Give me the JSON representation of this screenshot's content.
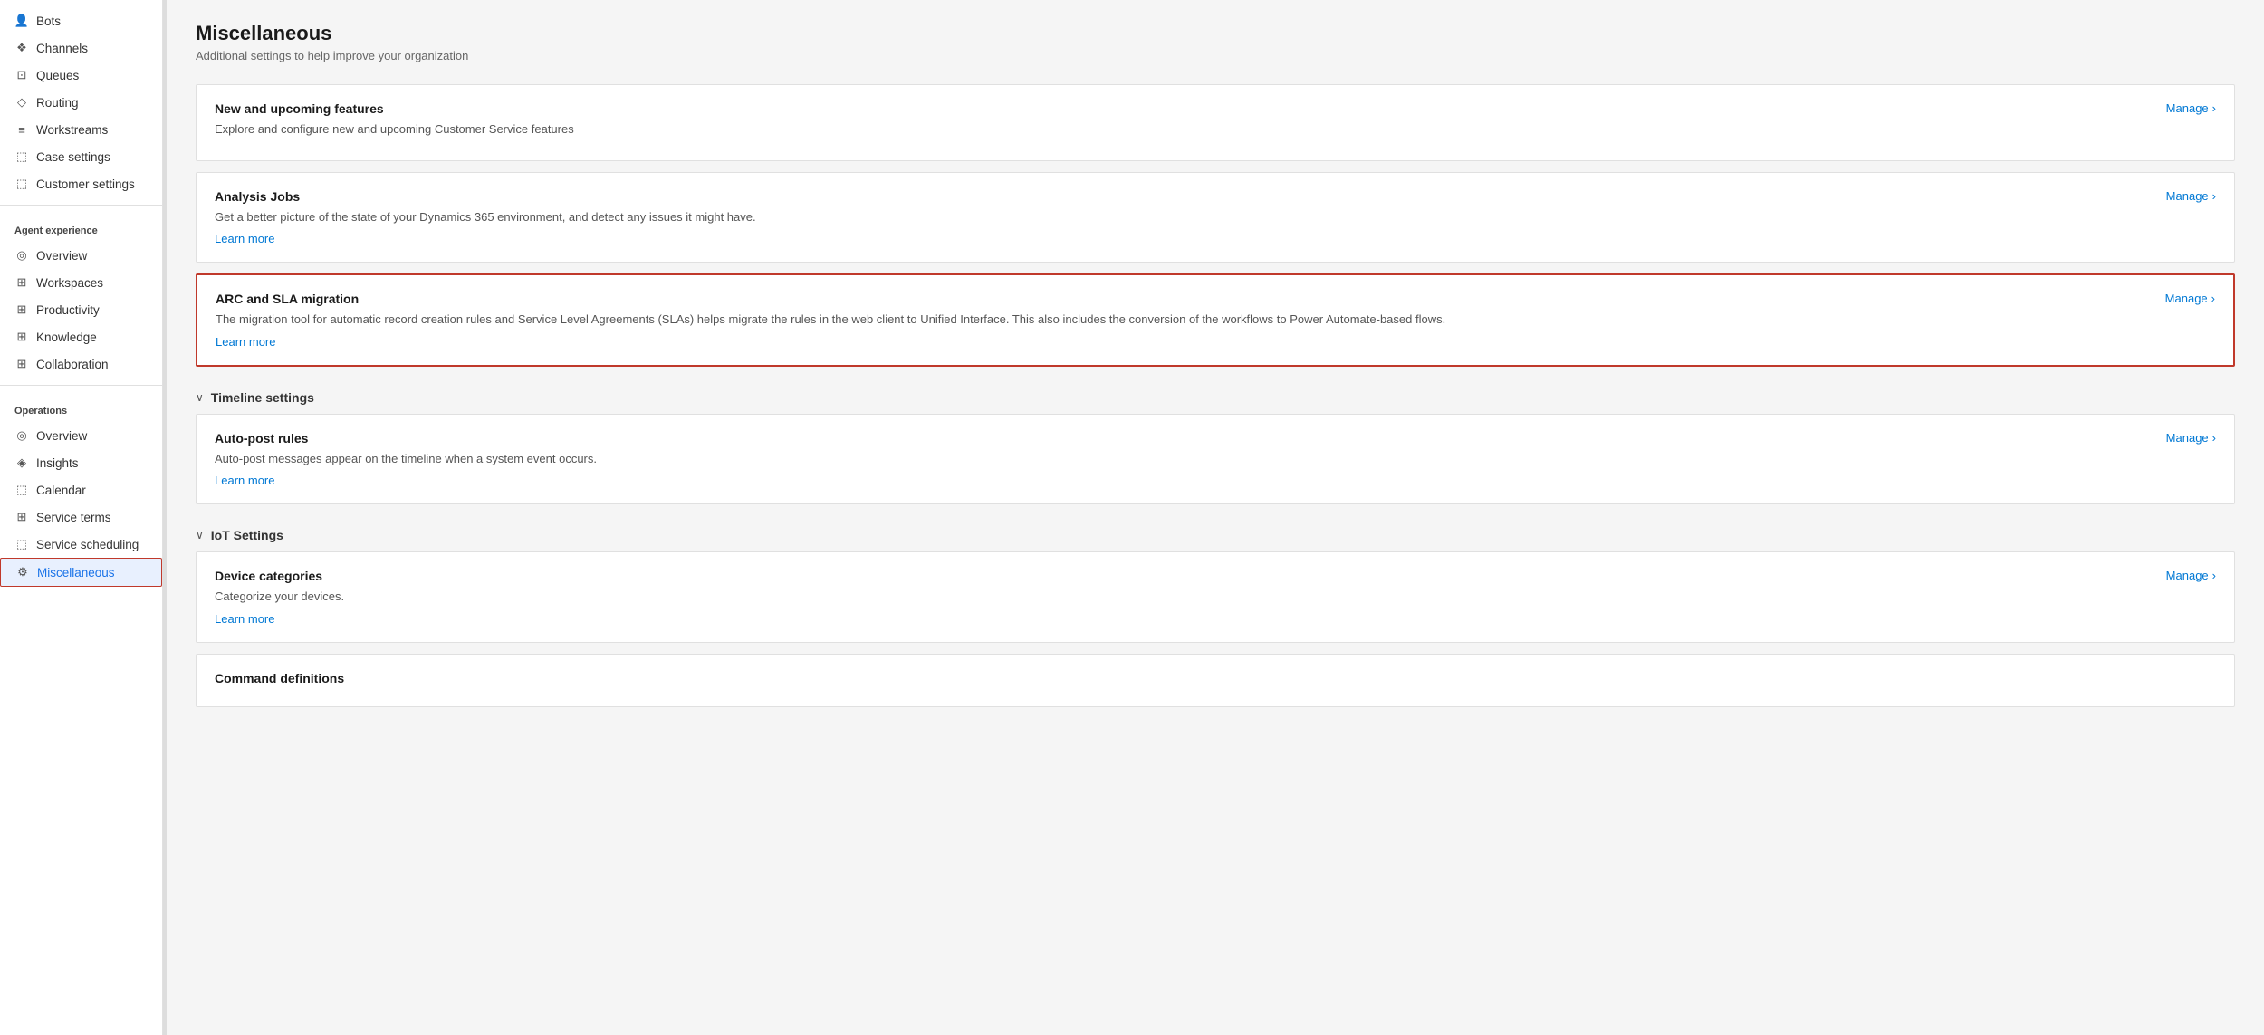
{
  "sidebar": {
    "sections": [
      {
        "items": [
          {
            "label": "Bots",
            "icon": "👤",
            "active": false
          },
          {
            "label": "Channels",
            "icon": "◈",
            "active": false
          },
          {
            "label": "Queues",
            "icon": "⊞",
            "active": false
          },
          {
            "label": "Routing",
            "icon": "◇",
            "active": false
          },
          {
            "label": "Workstreams",
            "icon": "≡",
            "active": false
          },
          {
            "label": "Case settings",
            "icon": "⬚",
            "active": false
          },
          {
            "label": "Customer settings",
            "icon": "⬚",
            "active": false
          }
        ]
      },
      {
        "header": "Agent experience",
        "items": [
          {
            "label": "Overview",
            "icon": "◎",
            "active": false
          },
          {
            "label": "Workspaces",
            "icon": "⊞",
            "active": false
          },
          {
            "label": "Productivity",
            "icon": "⊞",
            "active": false
          },
          {
            "label": "Knowledge",
            "icon": "⊞",
            "active": false
          },
          {
            "label": "Collaboration",
            "icon": "⊞",
            "active": false
          }
        ]
      },
      {
        "header": "Operations",
        "items": [
          {
            "label": "Overview",
            "icon": "◎",
            "active": false
          },
          {
            "label": "Insights",
            "icon": "◈",
            "active": false
          },
          {
            "label": "Calendar",
            "icon": "⬚",
            "active": false
          },
          {
            "label": "Service terms",
            "icon": "⊞",
            "active": false
          },
          {
            "label": "Service scheduling",
            "icon": "⬚",
            "active": false
          },
          {
            "label": "Miscellaneous",
            "icon": "⚙",
            "active": true
          }
        ]
      }
    ]
  },
  "page": {
    "title": "Miscellaneous",
    "subtitle": "Additional settings to help improve your organization"
  },
  "cards": [
    {
      "id": "new-features",
      "title": "New and upcoming features",
      "desc": "Explore and configure new and upcoming Customer Service features",
      "link": null,
      "manage_label": "Manage",
      "highlighted": false
    },
    {
      "id": "analysis-jobs",
      "title": "Analysis Jobs",
      "desc": "Get a better picture of the state of your Dynamics 365 environment, and detect any issues it might have.",
      "link": "Learn more",
      "manage_label": "Manage",
      "highlighted": false
    },
    {
      "id": "arc-sla",
      "title": "ARC and SLA migration",
      "desc": "The migration tool for automatic record creation rules and Service Level Agreements (SLAs) helps migrate the rules in the web client to Unified Interface. This also includes the conversion of the workflows to Power Automate-based flows.",
      "link": "Learn more",
      "manage_label": "Manage",
      "highlighted": true
    }
  ],
  "sections": [
    {
      "id": "timeline",
      "title": "Timeline settings",
      "cards": [
        {
          "id": "auto-post",
          "title": "Auto-post rules",
          "desc": "Auto-post messages appear on the timeline when a system event occurs.",
          "link": "Learn more",
          "manage_label": "Manage",
          "highlighted": false
        }
      ]
    },
    {
      "id": "iot",
      "title": "IoT Settings",
      "cards": [
        {
          "id": "device-categories",
          "title": "Device categories",
          "desc": "Categorize your devices.",
          "link": "Learn more",
          "manage_label": "Manage",
          "highlighted": false
        },
        {
          "id": "command-definitions",
          "title": "Command definitions",
          "desc": "",
          "link": null,
          "manage_label": null,
          "highlighted": false
        }
      ]
    }
  ],
  "icons": {
    "chevron_right": "›",
    "chevron_down": "∨"
  }
}
